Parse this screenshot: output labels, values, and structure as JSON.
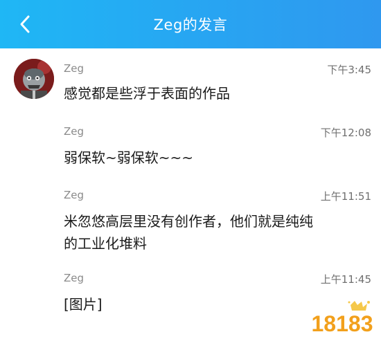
{
  "header": {
    "title": "Zeg的发言"
  },
  "messages": [
    {
      "name": "Zeg",
      "time": "下午3:45",
      "text": "感觉都是些浮于表面的作品"
    },
    {
      "name": "Zeg",
      "time": "下午12:08",
      "text": "弱保软~弱保软~~~"
    },
    {
      "name": "Zeg",
      "time": "上午11:51",
      "text_line1": "米忽悠高层里没有创作者，他们就是纯纯",
      "text_line2": "的工业化堆料"
    },
    {
      "name": "Zeg",
      "time": "上午11:45",
      "text": "[图片]"
    }
  ],
  "watermark": {
    "text": "18183"
  },
  "colors": {
    "header_start": "#1fb7f5",
    "header_end": "#2f98ef",
    "name_gray": "#8a8a8a",
    "message_text": "#1a1a1a",
    "watermark_orange": "#f2a01c"
  }
}
